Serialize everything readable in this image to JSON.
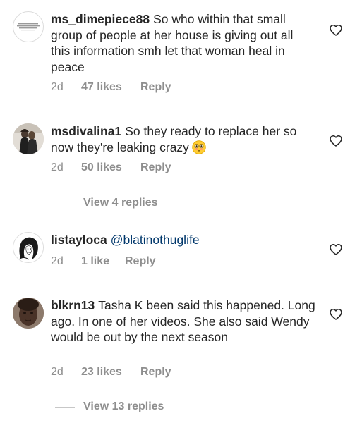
{
  "comments": [
    {
      "username": "ms_dimepiece88",
      "text": "So who within that small group of people at her house is giving out all this information smh let that woman heal in peace",
      "age": "2d",
      "likes": "47 likes",
      "reply": "Reply",
      "avatar": "text-logo-avatar"
    },
    {
      "username": "msdivalina1",
      "text": "So they ready to replace her so now they're leaking crazy",
      "emoji": "flushed-face-emoji",
      "age": "2d",
      "likes": "50 likes",
      "reply": "Reply",
      "avatar": "photo-avatar",
      "view_replies": "View 4 replies"
    },
    {
      "username": "listayloca",
      "mention": "@blatinothuglife",
      "age": "2d",
      "likes": "1 like",
      "reply": "Reply",
      "avatar": "illustration-avatar"
    },
    {
      "username": "blkrn13",
      "text": "Tasha K been said this happened. Long ago. In one of her videos. She also said Wendy would be out by the next season",
      "age": "2d",
      "likes": "23 likes",
      "reply": "Reply",
      "avatar": "photo-avatar",
      "view_replies": "View 13 replies"
    }
  ],
  "colors": {
    "text": "#262626",
    "secondary": "#8e8e8e",
    "mention": "#00376b",
    "divider": "#c7c7c7"
  },
  "icons": {
    "like": "heart-outline-icon"
  }
}
